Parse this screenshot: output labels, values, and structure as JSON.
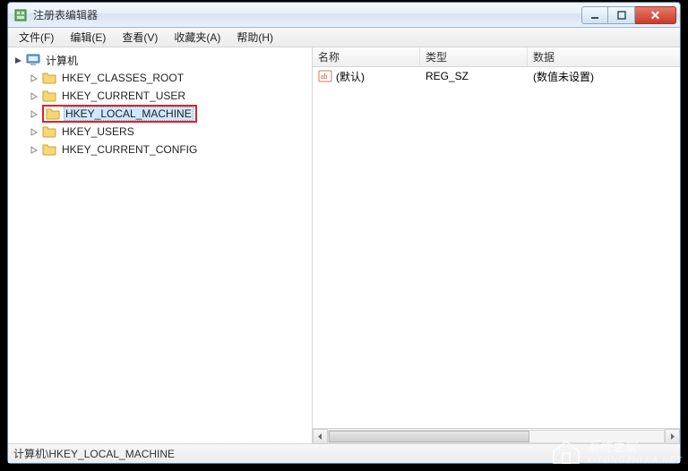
{
  "window": {
    "title": "注册表编辑器"
  },
  "menu": {
    "file": "文件(F)",
    "edit": "编辑(E)",
    "view": "查看(V)",
    "favorites": "收藏夹(A)",
    "help": "帮助(H)"
  },
  "tree": {
    "root_label": "计算机",
    "hives": [
      {
        "label": "HKEY_CLASSES_ROOT",
        "selected": false,
        "highlighted": false
      },
      {
        "label": "HKEY_CURRENT_USER",
        "selected": false,
        "highlighted": false
      },
      {
        "label": "HKEY_LOCAL_MACHINE",
        "selected": true,
        "highlighted": true
      },
      {
        "label": "HKEY_USERS",
        "selected": false,
        "highlighted": false
      },
      {
        "label": "HKEY_CURRENT_CONFIG",
        "selected": false,
        "highlighted": false
      }
    ]
  },
  "list": {
    "columns": {
      "name": "名称",
      "type": "类型",
      "data": "数据"
    },
    "rows": [
      {
        "name": "(默认)",
        "type": "REG_SZ",
        "data": "(数值未设置)"
      }
    ]
  },
  "statusbar": {
    "path": "计算机\\HKEY_LOCAL_MACHINE"
  },
  "watermark": {
    "text": "系统之家",
    "sub": "XITONGZHIJIA.NET"
  }
}
